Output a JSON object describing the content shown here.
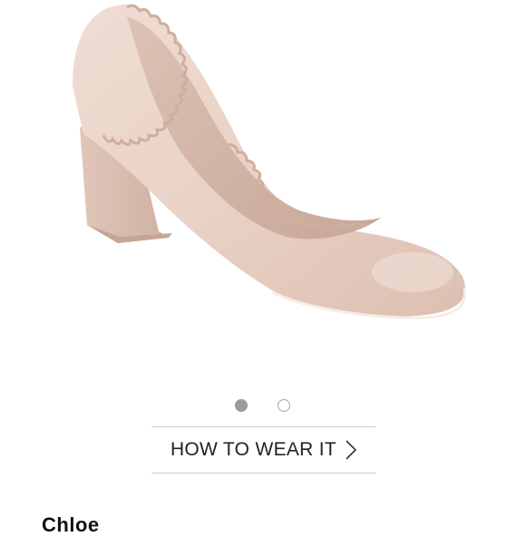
{
  "product": {
    "image_icon": "scalloped-block-heel-pump-image",
    "shoe_color": "#e9d3c8"
  },
  "carousel": {
    "active_index": 1,
    "total": 2
  },
  "how_to_wear": {
    "label": "HOW TO WEAR IT",
    "icon": "chevron-right-icon"
  },
  "brand": {
    "name": "Chloe"
  }
}
